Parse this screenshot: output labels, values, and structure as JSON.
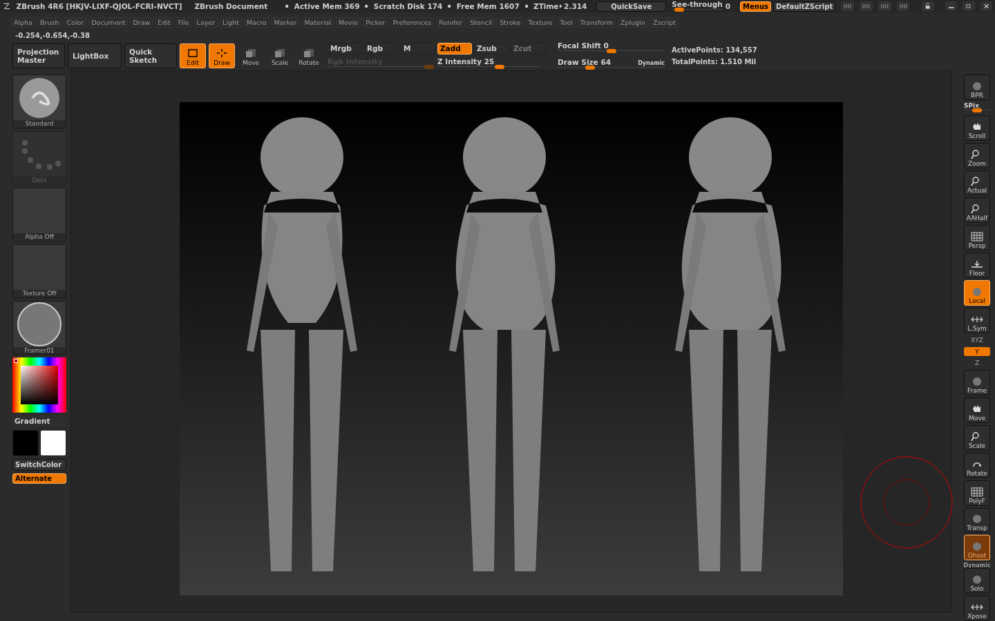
{
  "title_bar": {
    "app": "ZBrush 4R6 [HKJV-LIXF-QJOL-FCRI-NVCT]",
    "document": "ZBrush Document",
    "stats": [
      "Active Mem 369",
      "Scratch Disk 174",
      "Free Mem 1607"
    ],
    "ztime_label": "ZTime",
    "ztime_value": "2.314",
    "quicksave": "QuickSave",
    "see_through": {
      "label": "See-through",
      "value": "0",
      "level": 0.05
    },
    "menus": {
      "label": "Menus",
      "on": true
    },
    "script": "DefaultZScript"
  },
  "menu_bar": [
    "Alpha",
    "Brush",
    "Color",
    "Document",
    "Draw",
    "Edit",
    "File",
    "Layer",
    "Light",
    "Macro",
    "Marker",
    "Material",
    "Movie",
    "Picker",
    "Preferences",
    "Render",
    "Stencil",
    "Stroke",
    "Texture",
    "Tool",
    "Transform",
    "Zplugin",
    "Zscript"
  ],
  "coordinates": "-0.254,-0.654,-0.38",
  "top_shelf": {
    "projection_master": "Projection Master",
    "lightbox": "LightBox",
    "quick_sketch": "Quick Sketch",
    "modes": [
      {
        "label": "Edit",
        "on": true
      },
      {
        "label": "Draw",
        "on": true
      },
      {
        "label": "Move",
        "on": false
      },
      {
        "label": "Scale",
        "on": false
      },
      {
        "label": "Rotate",
        "on": false
      }
    ],
    "channels": [
      {
        "label": "Mrgb",
        "on": false,
        "disabled": false
      },
      {
        "label": "Rgb",
        "on": false,
        "disabled": false
      },
      {
        "label": "M",
        "on": false,
        "disabled": false
      },
      {
        "label": "Zadd",
        "on": true,
        "disabled": false
      },
      {
        "label": "Zsub",
        "on": false,
        "disabled": false
      },
      {
        "label": "Zcut",
        "on": false,
        "disabled": true
      }
    ],
    "rgb_intensity": {
      "label": "Rgb Intensity",
      "disabled": true,
      "level": 0.95
    },
    "z_intensity": {
      "label": "Z Intensity 25",
      "disabled": false,
      "level": 0.6
    },
    "focal_shift": {
      "label": "Focal Shift 0",
      "level": 0.5
    },
    "draw_size": {
      "label": "Draw Size 64",
      "level": 0.3
    },
    "dynamic": "Dynamic",
    "active_points": "ActivePoints: 134,557",
    "total_points": "TotalPoints: 1.510 Mil"
  },
  "left_shelf": {
    "tiles": [
      {
        "label": "Standard",
        "disabled": false
      },
      {
        "label": "Dots",
        "disabled": true
      },
      {
        "label": "Alpha Off",
        "disabled": false
      },
      {
        "label": "Texture Off",
        "disabled": false
      },
      {
        "label": "Framer01",
        "disabled": false
      }
    ],
    "gradient": "Gradient",
    "switch_color": "SwitchColor",
    "alternate": {
      "label": "Alternate",
      "on": true
    }
  },
  "right_shelf": [
    {
      "kind": "button",
      "label": "BPR",
      "on": false,
      "disabled": false
    },
    {
      "kind": "slider",
      "label": "SPix",
      "level": 0.5
    },
    {
      "kind": "button",
      "label": "Scroll",
      "on": false,
      "disabled": false
    },
    {
      "kind": "button",
      "label": "Zoom",
      "on": false,
      "disabled": false
    },
    {
      "kind": "button",
      "label": "Actual",
      "on": false,
      "disabled": false
    },
    {
      "kind": "button",
      "label": "AAHalf",
      "on": false,
      "disabled": false
    },
    {
      "kind": "button",
      "label": "Persp",
      "on": false,
      "disabled": false
    },
    {
      "kind": "button",
      "label": "Floor",
      "on": false,
      "disabled": false
    },
    {
      "kind": "button",
      "label": "Local",
      "on": true,
      "disabled": false
    },
    {
      "kind": "button",
      "label": "L.Sym",
      "on": false,
      "disabled": false
    },
    {
      "kind": "axis",
      "label": "XYZ",
      "on": false
    },
    {
      "kind": "axis",
      "label": "Y",
      "on": true
    },
    {
      "kind": "axis",
      "label": "Z",
      "on": false
    },
    {
      "kind": "button",
      "label": "Frame",
      "on": false,
      "disabled": false
    },
    {
      "kind": "button",
      "label": "Move",
      "on": false,
      "disabled": false
    },
    {
      "kind": "button",
      "label": "Scale",
      "on": false,
      "disabled": false
    },
    {
      "kind": "button",
      "label": "Rotate",
      "on": false,
      "disabled": false
    },
    {
      "kind": "button",
      "label": "PolyF",
      "on": false,
      "disabled": false
    },
    {
      "kind": "button",
      "label": "Transp",
      "on": false,
      "disabled": false
    },
    {
      "kind": "button",
      "label": "Ghost",
      "on": true,
      "disabled": true
    },
    {
      "kind": "caption",
      "label": "Dynamic"
    },
    {
      "kind": "button",
      "label": "Solo",
      "on": false,
      "disabled": false
    },
    {
      "kind": "button",
      "label": "Xpose",
      "on": false,
      "disabled": false
    }
  ]
}
